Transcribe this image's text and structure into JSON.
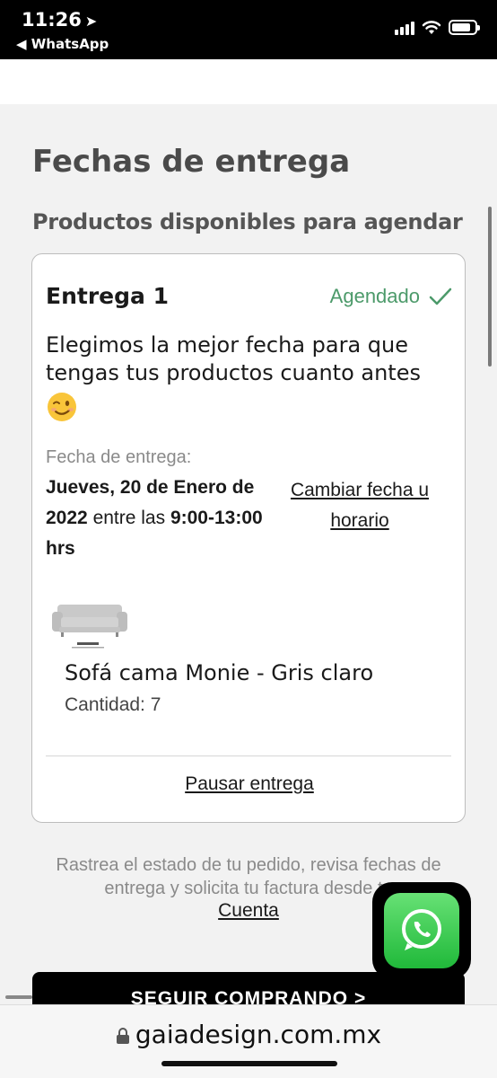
{
  "status_bar": {
    "time": "11:26",
    "back_label": "◀ WhatsApp",
    "location_icon": "location-arrow-icon",
    "signal_icon": "cell-signal-icon",
    "wifi_icon": "wifi-icon",
    "battery_icon": "battery-icon",
    "battery_level": 0.85
  },
  "page": {
    "title": "Fechas de entrega",
    "subtitle": "Productos disponibles para agendar"
  },
  "delivery": {
    "title": "Entrega 1",
    "status": "Agendado",
    "status_color": "#4c9a6a",
    "message": "Elegimos la mejor fecha para que tengas tus productos cuanto antes",
    "emoji_icon": "winking-face-icon",
    "date_label": "Fecha de entrega:",
    "date_bold_1": "Jueves, 20 de Enero de 2022",
    "date_between": "entre las",
    "date_bold_2": "9:00-13:00 hrs",
    "change_link": "Cambiar fecha u horario",
    "product": {
      "name": "Sofá cama Monie - Gris claro",
      "quantity": "Cantidad: 7",
      "image_icon": "sofa-image"
    },
    "pause_link": "Pausar entrega"
  },
  "footer": {
    "text": "Rastrea el estado de tu pedido, revisa fechas de entrega y solicita tu factura desde tu",
    "link": "Cuenta"
  },
  "continue_button": "SEGUIR COMPRANDO >",
  "whatsapp_fab_icon": "whatsapp-icon",
  "url_bar": {
    "lock_icon": "lock-icon",
    "url": "gaiadesign.com.mx"
  }
}
